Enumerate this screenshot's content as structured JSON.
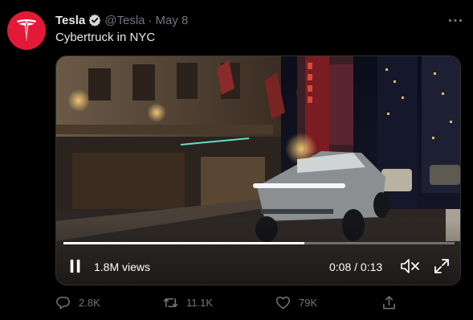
{
  "author": {
    "name": "Tesla",
    "handle": "@Tesla",
    "separator": "·",
    "date": "May 8",
    "avatar_icon": "tesla-logo",
    "verified_icon": "verified-badge-icon"
  },
  "tweet": {
    "text": "Cybertruck in NYC"
  },
  "video": {
    "views": "1.8M views",
    "time": "0:08 / 0:13",
    "progress": 0.615
  },
  "actions": {
    "replies": "2.8K",
    "retweets": "11.1K",
    "likes": "79K"
  },
  "colors": {
    "background": "#000000",
    "text": "#e7e9ea",
    "secondary_text": "#71767b",
    "avatar_red": "#e31937"
  }
}
